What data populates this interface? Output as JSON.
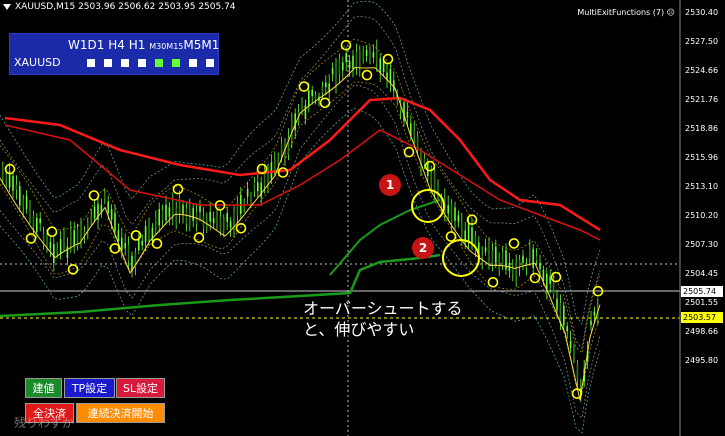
{
  "header": {
    "symbol_info": "XAUUSD,M15  2503.96 2506.62 2503.95 2505.74"
  },
  "indicator_label": "MultiExitFunctions (7)",
  "timeframe_panel": {
    "tf_w1": "W1",
    "tf_d1": "D1",
    "tf_h4": "H4",
    "tf_h1": "H1",
    "tf_m30": "M30",
    "tf_m15": "M15",
    "tf_m5": "M5",
    "tf_m1": "M1",
    "symbol": "XAUUSD",
    "status": [
      "white",
      "white",
      "white",
      "white",
      "green",
      "green",
      "white",
      "white"
    ]
  },
  "buttons": {
    "entry": "建値",
    "tp": "TP設定",
    "sl": "SL設定",
    "close_all": "全決済",
    "chain_close": "連続決済開始"
  },
  "annotation": {
    "line1": "オーバーシュートする",
    "line2": "と、伸びやすい"
  },
  "badges": {
    "one": "1",
    "two": "2"
  },
  "price_axis": [
    "2530.40",
    "2527.50",
    "2524.66",
    "2521.76",
    "2518.86",
    "2515.96",
    "2513.10",
    "2510.20",
    "2507.30",
    "2504.45",
    "2501.55",
    "2498.66",
    "2495.80"
  ],
  "price_tags": {
    "current": "2505.74",
    "yellow": "2503.57"
  },
  "bottom_fragment": "残りわずか",
  "colors": {
    "background": "#000000",
    "bull_candle": "#66ff33",
    "ma_red": "#ff1a1a",
    "ma_green": "#1a9a1a",
    "marker": "#ffff00",
    "panel": "#1a2aa8"
  }
}
